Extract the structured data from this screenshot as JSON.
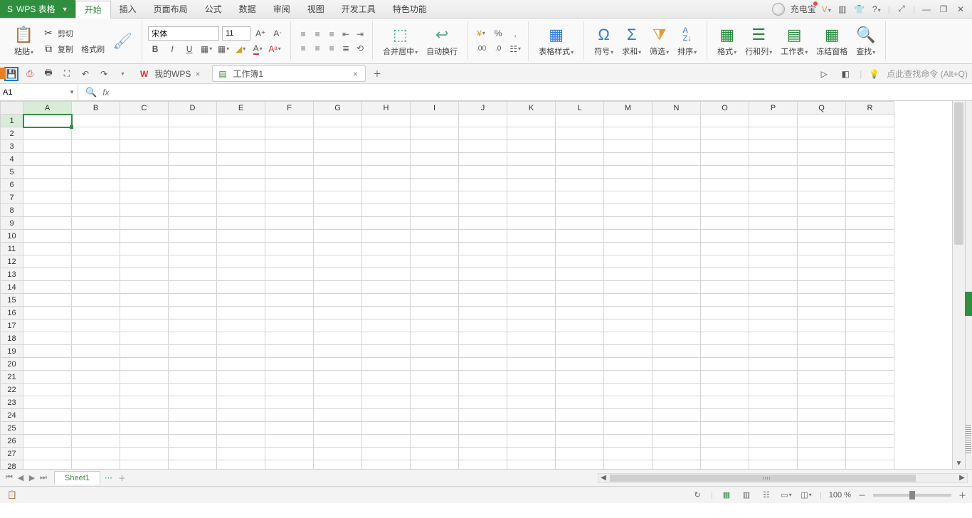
{
  "app": {
    "name": "WPS 表格"
  },
  "menu": {
    "tabs": [
      "开始",
      "插入",
      "页面布局",
      "公式",
      "数据",
      "审阅",
      "视图",
      "开发工具",
      "特色功能"
    ],
    "active": 0
  },
  "titlebar": {
    "user": "充电宝",
    "help": "?",
    "min": "—",
    "restore": "❐",
    "close": "✕"
  },
  "ribbon": {
    "paste": "粘贴",
    "cut": "剪切",
    "copy": "复制",
    "fmtpaint": "格式刷",
    "font_name": "宋体",
    "font_size": "11",
    "merge": "合并居中",
    "wrap": "自动换行",
    "percent": "%",
    "comma": ",",
    "tablestyle": "表格样式",
    "symbol": "符号",
    "sum": "求和",
    "filter": "筛选",
    "sort": "排序",
    "format": "格式",
    "rowcol": "行和列",
    "worksheet": "工作表",
    "freeze": "冻结窗格",
    "find": "查找"
  },
  "quickbar": {
    "doc1": "我的WPS",
    "doc2": "工作簿1",
    "find_hint": "点此查找命令",
    "shortcut": "(Alt+Q)"
  },
  "formula": {
    "cellref": "A1"
  },
  "grid": {
    "cols": [
      "A",
      "B",
      "C",
      "D",
      "E",
      "F",
      "G",
      "H",
      "I",
      "J",
      "K",
      "L",
      "M",
      "N",
      "O",
      "P",
      "Q",
      "R"
    ],
    "rows": 28,
    "sel": {
      "row": 1,
      "col": 0
    }
  },
  "sheets": {
    "tab1": "Sheet1"
  },
  "status": {
    "zoom": "100 %",
    "minus": "－",
    "plus": "＋"
  }
}
